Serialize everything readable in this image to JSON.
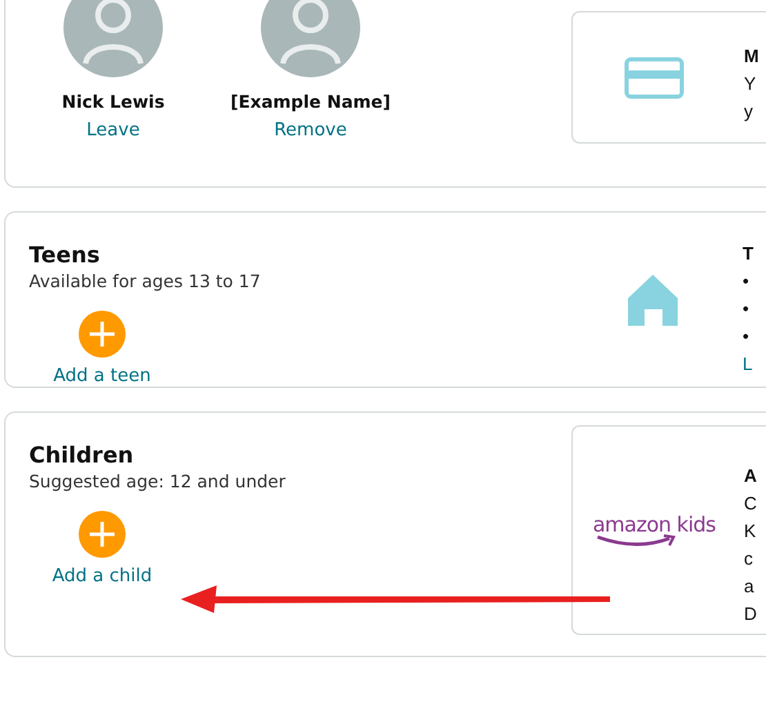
{
  "household": {
    "members": [
      {
        "name": "Nick Lewis",
        "action": "Leave"
      },
      {
        "name": "[Example Name]",
        "action": "Remove"
      }
    ],
    "side_panel": {
      "lines": [
        "M",
        "Y",
        "y"
      ]
    }
  },
  "sections": [
    {
      "title": "Teens",
      "subtitle": "Available for ages 13 to 17",
      "add_label": "Add a teen",
      "side": {
        "heading": "T",
        "bullets": [
          "•",
          "•",
          "•"
        ],
        "link": "L",
        "bordered": false
      }
    },
    {
      "title": "Children",
      "subtitle": "Suggested age: 12 and under",
      "add_label": "Add a child",
      "side": {
        "logo": "amazon kids",
        "heading": "A",
        "lines": [
          "C",
          "K",
          "c",
          "a",
          "D"
        ],
        "bordered": true
      },
      "annotation": {
        "kind": "arrow",
        "color": "#e8201f"
      }
    }
  ]
}
